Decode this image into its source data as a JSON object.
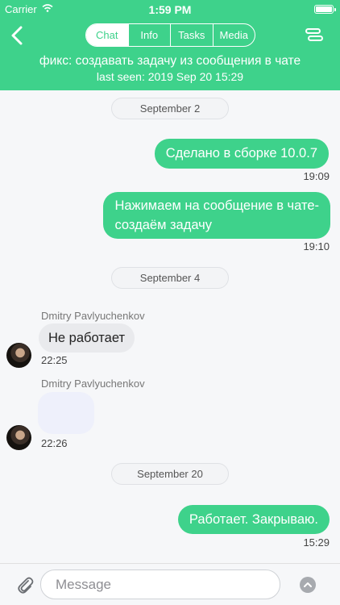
{
  "status_bar": {
    "carrier": "Carrier",
    "time": "1:59 PM"
  },
  "header": {
    "tabs": [
      {
        "label": "Chat",
        "active": true
      },
      {
        "label": "Info",
        "active": false
      },
      {
        "label": "Tasks",
        "active": false
      },
      {
        "label": "Media",
        "active": false
      }
    ],
    "title": "фикс: создавать задачу из сообщения в чате",
    "subtitle": "last seen: 2019 Sep 20 15:29"
  },
  "messages": {
    "date_1": "September 2",
    "msg_1": {
      "text": "Сделано в сборке 10.0.7",
      "time": "19:09"
    },
    "msg_2": {
      "line1": "Нажимаем на сообщение в чате-",
      "line2": "создаём задачу",
      "time": "19:10"
    },
    "date_2": "September 4",
    "msg_3": {
      "sender": "Dmitry Pavlyuchenkov",
      "text": "Не работает",
      "time": "22:25"
    },
    "msg_4": {
      "sender": "Dmitry Pavlyuchenkov",
      "time": "22:26"
    },
    "date_3": "September 20",
    "msg_5": {
      "text": "Работает. Закрываю.",
      "time": "15:29"
    }
  },
  "composer": {
    "placeholder": "Message"
  },
  "colors": {
    "accent": "#3ed28b",
    "incoming_bubble": "#e9eaed",
    "background": "#f6f7f9"
  }
}
